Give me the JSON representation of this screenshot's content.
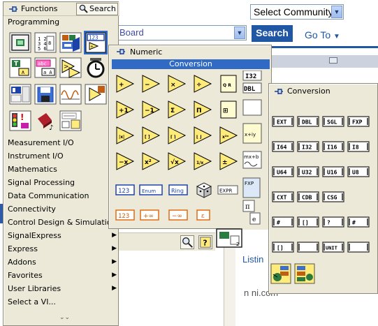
{
  "browser": {
    "select_community": "Select Community",
    "board_field": "Board",
    "search_button": "Search",
    "goto_link": "Go To",
    "listing_text": "Listin",
    "footer_text": "n ni.com",
    "accent_blue": "#1f57a4"
  },
  "functions_palette": {
    "title": "Functions",
    "search_label": "Search",
    "category": "Programming",
    "menu_items": [
      {
        "label": "Measurement I/O",
        "submenu": true
      },
      {
        "label": "Instrument I/O",
        "submenu": true
      },
      {
        "label": "Mathematics",
        "submenu": true
      },
      {
        "label": "Signal Processing",
        "submenu": true
      },
      {
        "label": "Data Communication",
        "submenu": true
      },
      {
        "label": "Connectivity",
        "submenu": true
      },
      {
        "label": "Control Design & Simulation",
        "submenu": true
      },
      {
        "label": "SignalExpress",
        "submenu": true
      },
      {
        "label": "Express",
        "submenu": true
      },
      {
        "label": "Addons",
        "submenu": true
      },
      {
        "label": "Favorites",
        "submenu": true
      },
      {
        "label": "User Libraries",
        "submenu": true
      },
      {
        "label": "Select a VI...",
        "submenu": false
      }
    ],
    "grid_icons": [
      "structures-icon",
      "array-icon",
      "cluster-icon",
      "numeric-icon",
      "boolean-icon",
      "string-icon",
      "comparison-icon",
      "timing-icon",
      "dialog-icon",
      "file-io-icon",
      "waveform-icon",
      "app-control-icon",
      "synchronization-icon",
      "graphics-sound-icon",
      "report-icon"
    ]
  },
  "numeric_palette": {
    "title": "Numeric",
    "subpalette_label": "Conversion",
    "side_labels": [
      "I32",
      "DBL"
    ],
    "ops": [
      "+",
      "−",
      "×",
      "÷",
      "Q R",
      "+1",
      "−1",
      "Σ",
      "Π",
      "⊞",
      "|x|",
      "[ ]",
      "⌈ ⌉",
      "⌊ ⌋",
      "x²ⁿ",
      "−x",
      "x²",
      "√x",
      "1/x",
      "±"
    ],
    "constants": [
      "123",
      "Enum",
      "Ring",
      "EXPR"
    ],
    "special_constants": [
      "123",
      "+∞",
      "−∞",
      "ε"
    ]
  },
  "conversion_palette": {
    "title": "Conversion",
    "tiles": [
      "EXT",
      "DBL",
      "SGL",
      "FXP",
      "I64",
      "I32",
      "I16",
      "I8",
      "U64",
      "U32",
      "U16",
      "U8",
      "CXT",
      "CDB",
      "CSG",
      "",
      "#",
      "[]",
      "?",
      "#",
      "[]",
      "",
      "UNIT",
      ""
    ]
  }
}
